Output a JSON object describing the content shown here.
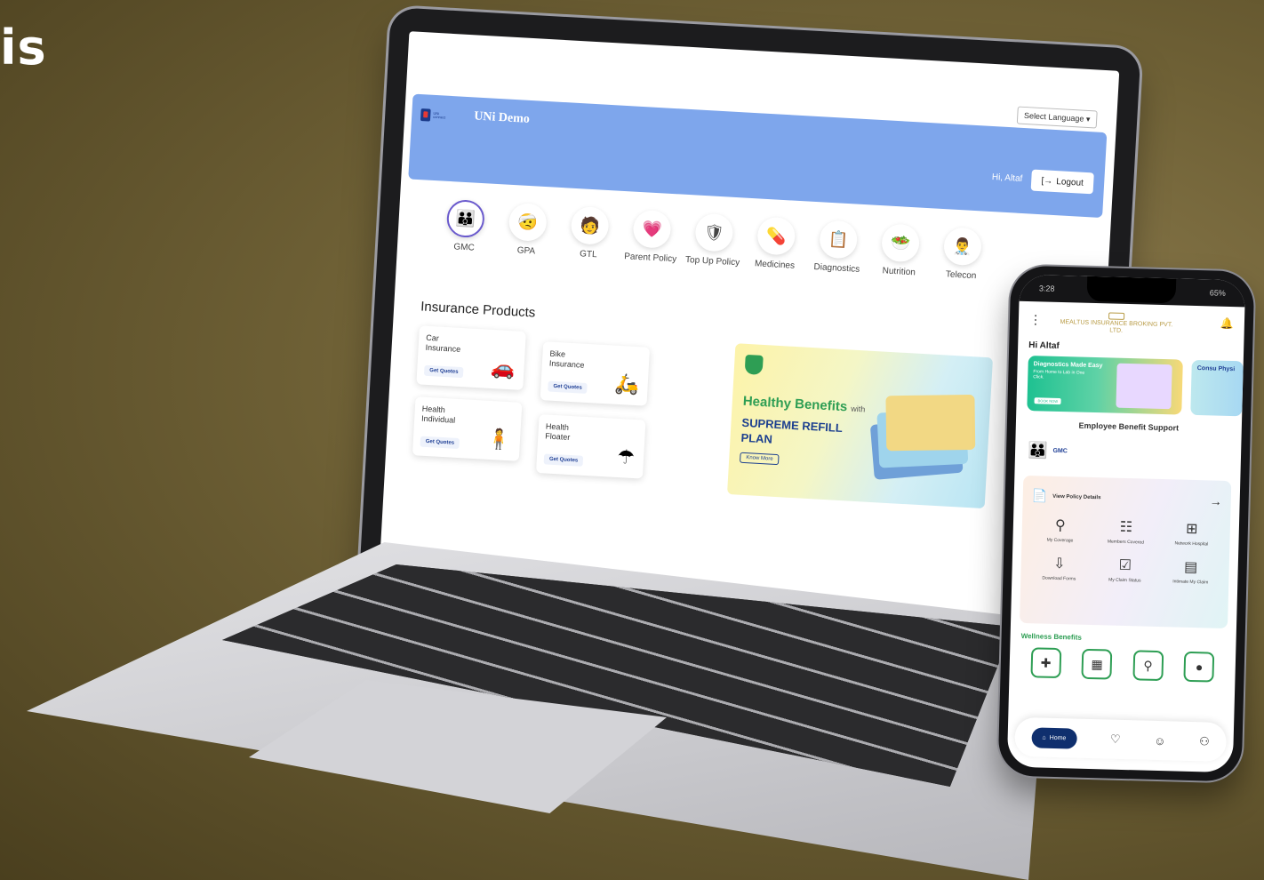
{
  "corner_text": "is",
  "laptop": {
    "app_title": "UNi Demo",
    "logo_sub": "UNi connect",
    "language_select": "Select Language",
    "greeting": "Hi, Altaf",
    "logout_label": "Logout",
    "categories": [
      {
        "label": "GMC",
        "icon": "family-icon"
      },
      {
        "label": "GPA",
        "icon": "accident-icon"
      },
      {
        "label": "GTL",
        "icon": "person-icon"
      },
      {
        "label": "Parent Policy",
        "icon": "heart-icon"
      },
      {
        "label": "Top Up Policy",
        "icon": "shield-icon"
      },
      {
        "label": "Medicines",
        "icon": "pill-icon"
      },
      {
        "label": "Diagnostics",
        "icon": "report-icon"
      },
      {
        "label": "Nutrition",
        "icon": "nutrition-icon"
      },
      {
        "label": "Telecon",
        "icon": "doctor-icon"
      }
    ],
    "section_title": "Insurance Products",
    "products": [
      {
        "name": "Car Insurance",
        "cta": "Get Quotes"
      },
      {
        "name": "Bike Insurance",
        "cta": "Get Quotes"
      },
      {
        "name": "Health Individual",
        "cta": "Get Quotes"
      },
      {
        "name": "Health Floater",
        "cta": "Get Quotes"
      }
    ],
    "banner": {
      "headline": "Healthy Benefits",
      "with": "with",
      "plan": "SUPREME REFILL PLAN",
      "button": "Know More"
    }
  },
  "phone": {
    "status_time": "3:28",
    "status_battery": "65%",
    "brand": "MEALTUS INSURANCE BROKING PVT. LTD.",
    "greeting": "Hi Altaf",
    "banner1_title": "Diagnostics Made Easy",
    "banner1_text": "From Home to Lab in One Click.",
    "banner1_button": "BOOK NOW",
    "banner2_title": "Consu Physi",
    "support_title": "Employee Benefit Support",
    "gmc_label": "GMC",
    "panel_title": "View Policy Details",
    "panel_items": [
      {
        "label": "My Coverage",
        "icon": "person-icon"
      },
      {
        "label": "Members Covered",
        "icon": "members-icon"
      },
      {
        "label": "Network Hospital",
        "icon": "hospital-icon"
      },
      {
        "label": "Download Forms",
        "icon": "download-icon"
      },
      {
        "label": "My Claim Status",
        "icon": "claim-status-icon"
      },
      {
        "label": "Intimate My Claim",
        "icon": "claim-icon"
      }
    ],
    "wellness_title": "Wellness Benefits",
    "nav_home": "Home"
  }
}
